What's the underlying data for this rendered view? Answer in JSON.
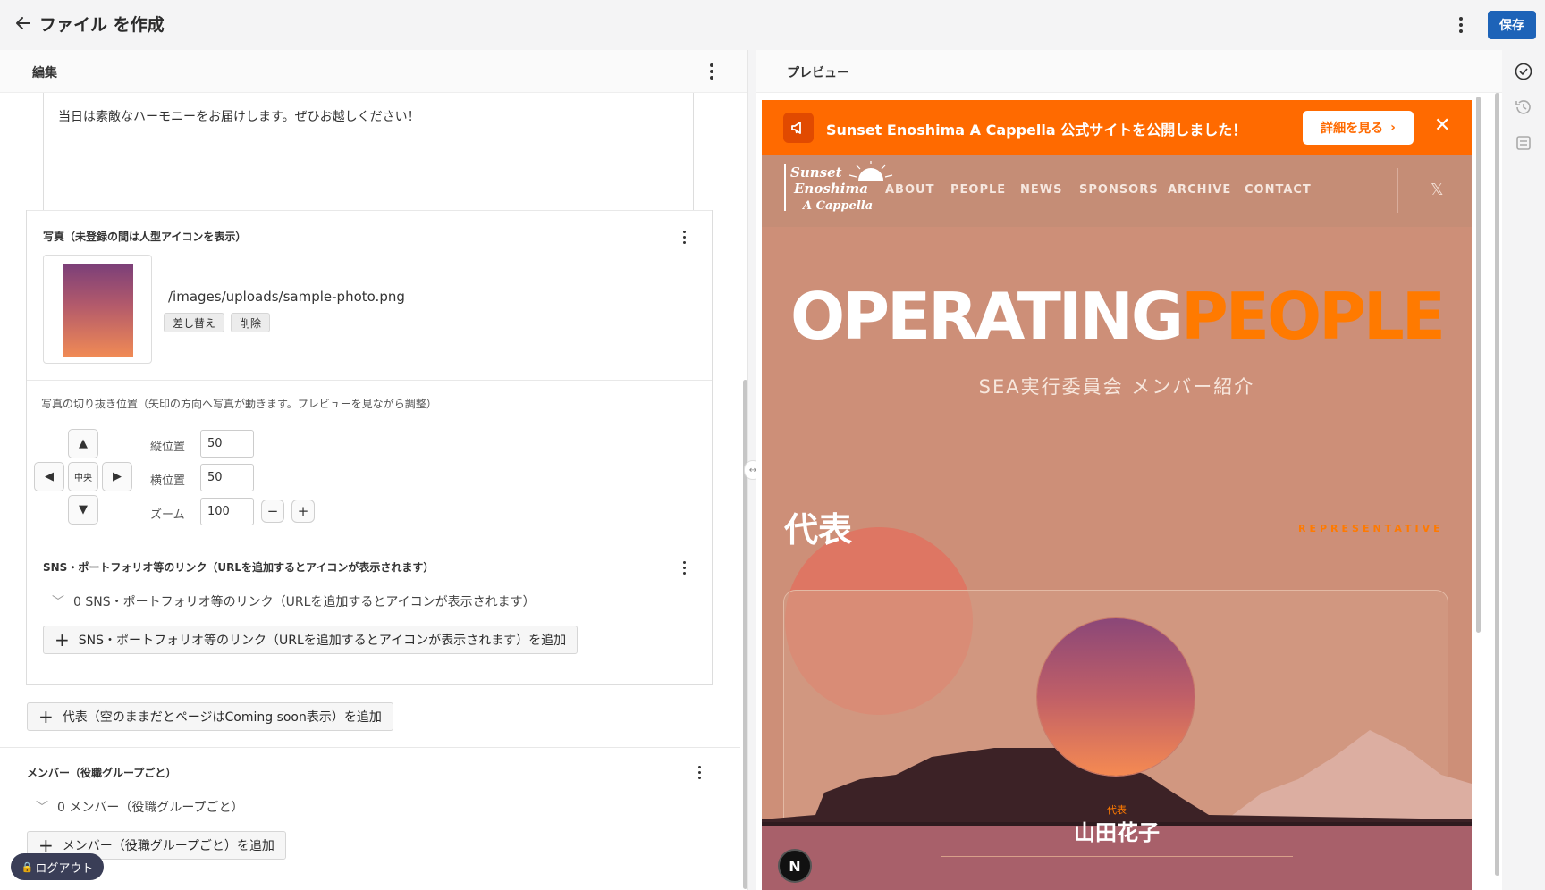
{
  "header": {
    "title": "ファイル を作成",
    "save_label": "保存"
  },
  "editor": {
    "heading": "編集",
    "body_text": "当日は素敵なハーモニーをお届けします。ぜひお越しください！",
    "photo": {
      "label": "写真（未登録の間は人型アイコンを表示）",
      "path": "/images/uploads/sample-photo.png",
      "replace_label": "差し替え",
      "delete_label": "削除"
    },
    "crop": {
      "hint": "写真の切り抜き位置（矢印の方向へ写真が動きます。プレビューを見ながら調整）",
      "center_label": "中央",
      "vertical_label": "縦位置",
      "vertical_value": "50",
      "horizontal_label": "横位置",
      "horizontal_value": "50",
      "zoom_label": "ズーム",
      "zoom_value": "100",
      "minus": "−",
      "plus": "+"
    },
    "sns": {
      "label": "SNS・ポートフォリオ等のリンク（URLを追加するとアイコンが表示されます）",
      "count_text": "0 SNS・ポートフォリオ等のリンク（URLを追加するとアイコンが表示されます）",
      "add_label": "SNS・ポートフォリオ等のリンク（URLを追加するとアイコンが表示されます）を追加"
    },
    "add_representative": "代表（空のままだとページはComing soon表示）を追加",
    "members": {
      "label": "メンバー（役職グループごと）",
      "count_text": "0 メンバー（役職グループごと）",
      "add_label": "メンバー（役職グループごと）を追加"
    },
    "logout": "ログアウト"
  },
  "preview": {
    "heading": "プレビュー",
    "banner": {
      "text": "Sunset Enoshima A Cappella 公式サイトを公開しました！",
      "more": "詳細を見る"
    },
    "nav": {
      "items": [
        "ABOUT",
        "PEOPLE",
        "NEWS",
        "SPONSORS",
        "ARCHIVE",
        "CONTACT"
      ],
      "logo_lines": [
        "Sunset",
        "Enoshima",
        "A Cappella"
      ]
    },
    "hero": {
      "title_white": "OPERATING",
      "title_orange": "PEOPLE",
      "subtitle": "SEA実行委員会 メンバー紹介"
    },
    "section": {
      "title": "代表",
      "en": "REPRESENTATIVE"
    },
    "card": {
      "role": "代表",
      "name": "山田花子"
    },
    "n_badge": "N"
  },
  "colors": {
    "accent_blue": "#1d63b8",
    "brand_orange": "#ff6a00",
    "hero_bg": "#cd8f78"
  }
}
